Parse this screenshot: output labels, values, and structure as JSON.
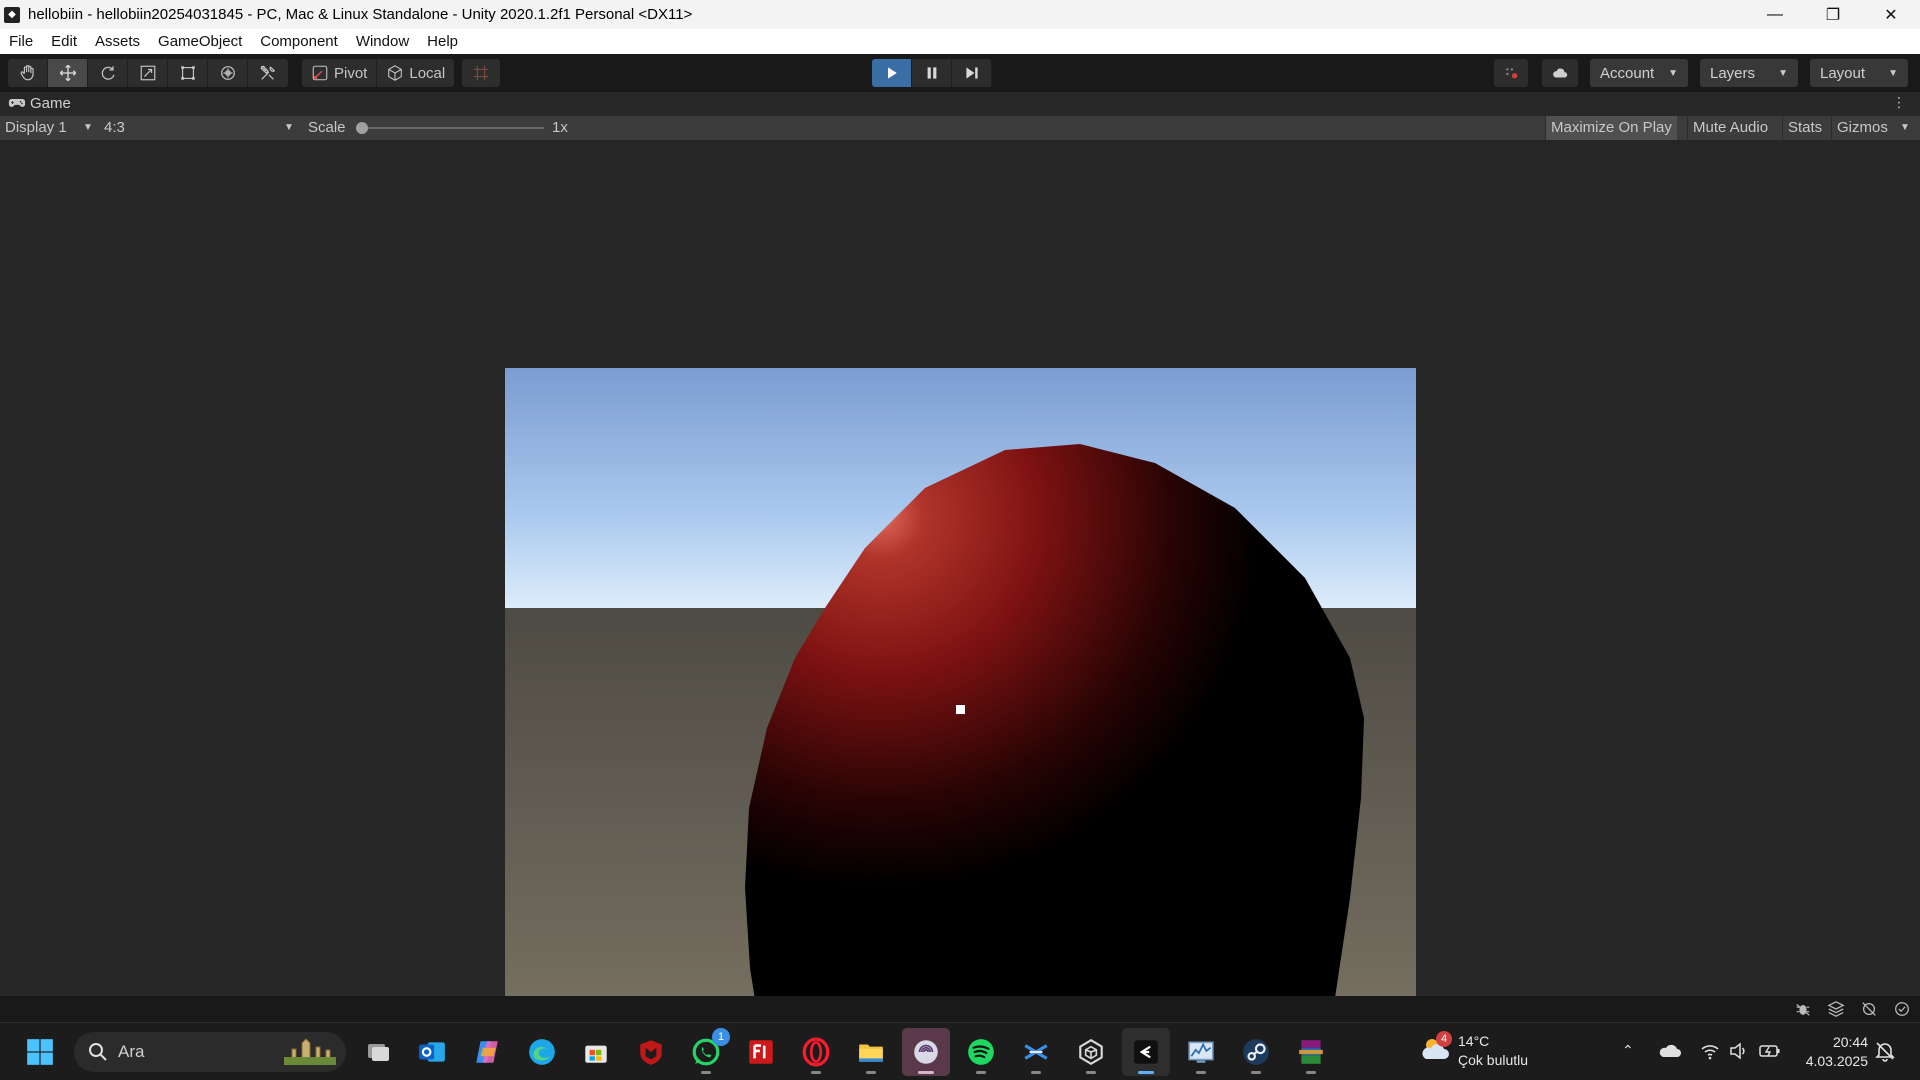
{
  "window": {
    "title": "hellobiin - hellobiin20254031845 - PC, Mac & Linux Standalone - Unity 2020.1.2f1 Personal <DX11>"
  },
  "menu": {
    "items": [
      "File",
      "Edit",
      "Assets",
      "GameObject",
      "Component",
      "Window",
      "Help"
    ]
  },
  "toolbar": {
    "tools": [
      "hand-tool",
      "move-tool",
      "rotate-tool",
      "scale-tool",
      "rect-tool",
      "transform-tool",
      "custom-tool"
    ],
    "active_tool": "move-tool",
    "pivot_label": "Pivot",
    "local_label": "Local",
    "play_state": "playing",
    "account_label": "Account",
    "layers_label": "Layers",
    "layout_label": "Layout"
  },
  "game_tab": {
    "label": "Game"
  },
  "game_toolbar": {
    "display": "Display 1",
    "aspect": "4:3",
    "scale_label": "Scale",
    "scale_value": "1x",
    "scale_fraction": 0.0,
    "maximize_label": "Maximize On Play",
    "mute_label": "Mute Audio",
    "stats_label": "Stats",
    "gizmos_label": "Gizmos"
  },
  "colors": {
    "play_active": "#3a6ea5",
    "capsule_red": "#8a1414",
    "sky_top": "#7a9cd0",
    "ground": "#57544c"
  },
  "taskbar": {
    "search_placeholder": "Ara",
    "apps": [
      "task-view",
      "outlook",
      "copilot",
      "edge",
      "microsoft-store",
      "mcafee",
      "whatsapp",
      "flash",
      "opera",
      "file-explorer",
      "ea-app",
      "spotify",
      "blender",
      "unity-hub",
      "unity-editor",
      "monitor-app",
      "steam",
      "winrar"
    ],
    "whatsapp_badge": "1",
    "weather_badge": "4",
    "weather_temp": "14°C",
    "weather_desc": "Çok bulutlu",
    "time": "20:44",
    "date": "4.03.2025"
  }
}
